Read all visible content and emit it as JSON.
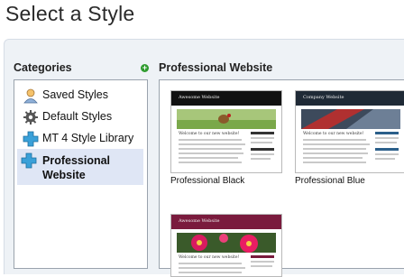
{
  "page": {
    "title": "Select a Style"
  },
  "categories": {
    "header": "Categories",
    "add_icon_text": "+",
    "items": [
      {
        "label": "Saved Styles",
        "icon": "person-icon"
      },
      {
        "label": "Default Styles",
        "icon": "gear-icon"
      },
      {
        "label": "MT 4 Style Library",
        "icon": "plus-cross-icon"
      },
      {
        "label": "Professional Website",
        "icon": "plus-cross-icon",
        "selected": true
      }
    ]
  },
  "styles": {
    "header": "Professional Website",
    "thumbnails": [
      {
        "label": "Professional Black",
        "band_text": "Awesome Website",
        "heading": "Welcome to our new website!",
        "band_color": "#111111",
        "accent": "#6aa84f"
      },
      {
        "label": "Professional Blue",
        "band_text": "Company Website",
        "heading": "Welcome to our new website!",
        "band_color": "#1f2a36",
        "accent": "#2b5f8a"
      },
      {
        "label": "",
        "band_text": "Awesome Website",
        "heading": "Welcome to our new website!",
        "band_color": "#7a1b3d",
        "accent": "#c2185b"
      }
    ]
  }
}
